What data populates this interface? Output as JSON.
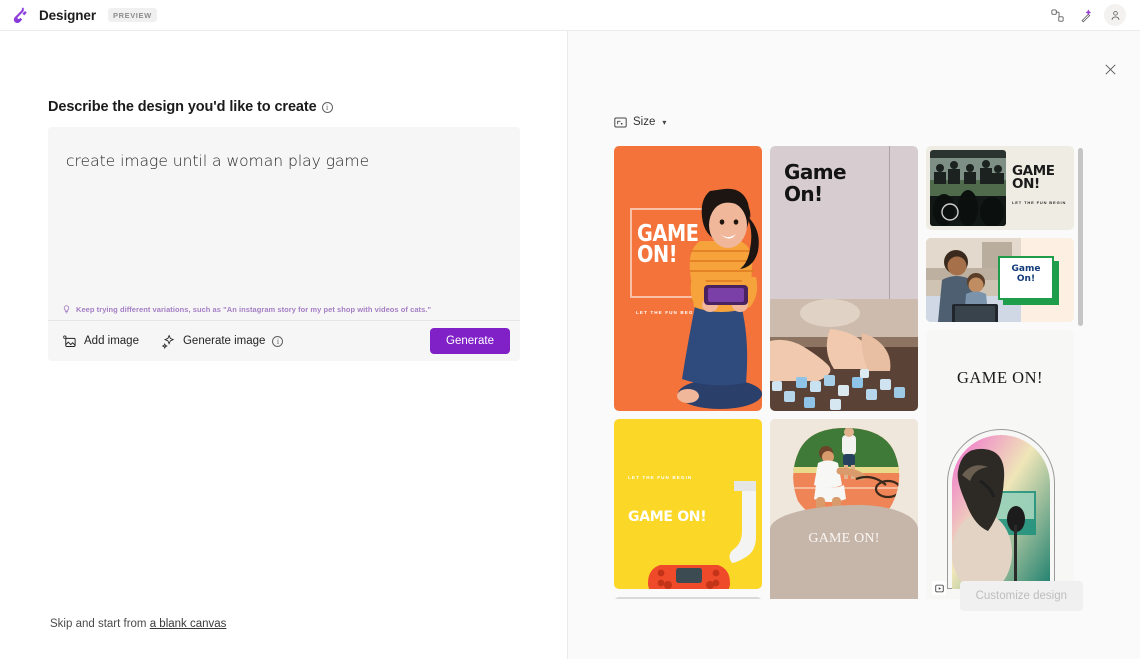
{
  "topbar": {
    "app_name": "Designer",
    "preview_badge": "PREVIEW",
    "icons": {
      "share": "share-icon",
      "sparkle": "sparkle-notification-icon",
      "account": "account-person-icon"
    }
  },
  "left": {
    "heading": "Describe the design you'd like to create",
    "heading_info": "ⓘ",
    "prompt_value": "create image until a woman play game",
    "prompt_placeholder": "Describe the design you'd like to create",
    "hint": "Keep trying different variations, such as \"An instagram story for my pet shop with videos of cats.\"",
    "add_image_label": "Add image",
    "generate_image_label": "Generate image",
    "generate_button": "Generate",
    "skip_text": "Skip and start from",
    "skip_link": "a blank canvas"
  },
  "right": {
    "close_label": "×",
    "size_label": "Size",
    "size_chevron": "⌄",
    "customize_button": "Customize design",
    "cards": [
      {
        "id": "card-orange-game-on",
        "title": "GAME ON!",
        "subtitle": "LET THE FUN BEGIN",
        "bg": "#f4733a"
      },
      {
        "id": "card-mauve-game-on",
        "title": "Game\nOn!",
        "bg": "#d7cdd1"
      },
      {
        "id": "card-stadium-game-on",
        "title": "GAME ON!",
        "subtitle": "LET THE FUN BEGIN",
        "bg": "#efece4"
      },
      {
        "id": "card-family-game-on",
        "title": "Game On!",
        "bg": "#fdf0e2"
      },
      {
        "id": "card-arch-game-on",
        "title": "GAME ON!",
        "bg": "#f7f7f5"
      },
      {
        "id": "card-yellow-game-on",
        "title": "GAME ON!",
        "subtitle": "LET THE FUN BEGIN",
        "bg": "#fbd727"
      },
      {
        "id": "card-tennis-game-on",
        "title": "GAME ON!",
        "bg": "#efe6dc"
      }
    ]
  }
}
